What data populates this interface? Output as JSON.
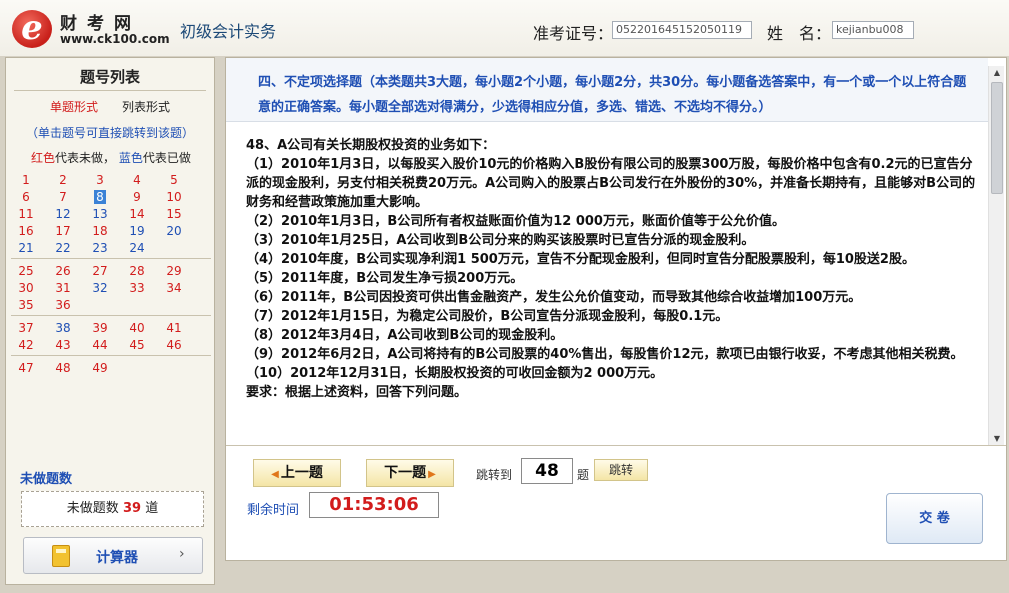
{
  "header": {
    "logo_name": "财考网",
    "logo_url": "www.ck100.com",
    "subject": "初级会计实务",
    "exam_no_label": "准考证号：",
    "exam_no_value": "052201645152050119",
    "name_label": "姓　名：",
    "name_value": "kejianbu008"
  },
  "sidebar": {
    "title": "题号列表",
    "mode_single": "单题形式",
    "mode_list": "列表形式",
    "jump_hint": "（单击题号可直接跳转到该题）",
    "legend_red": "红色",
    "legend_red_text": "代表未做，",
    "legend_blue": "蓝色",
    "legend_blue_text": "代表已做",
    "questions": [
      {
        "n": "1",
        "done": false
      },
      {
        "n": "2",
        "done": false
      },
      {
        "n": "3",
        "done": false
      },
      {
        "n": "4",
        "done": false
      },
      {
        "n": "5",
        "done": false
      },
      {
        "n": "6",
        "done": false
      },
      {
        "n": "7",
        "done": false
      },
      {
        "n": "8",
        "done": false,
        "current": true
      },
      {
        "n": "9",
        "done": false
      },
      {
        "n": "10",
        "done": false
      },
      {
        "n": "11",
        "done": false
      },
      {
        "n": "12",
        "done": true
      },
      {
        "n": "13",
        "done": true
      },
      {
        "n": "14",
        "done": false
      },
      {
        "n": "15",
        "done": false
      },
      {
        "n": "16",
        "done": false
      },
      {
        "n": "17",
        "done": false
      },
      {
        "n": "18",
        "done": false
      },
      {
        "n": "19",
        "done": true
      },
      {
        "n": "20",
        "done": true
      },
      {
        "n": "21",
        "done": true
      },
      {
        "n": "22",
        "done": true
      },
      {
        "n": "23",
        "done": true
      },
      {
        "n": "24",
        "done": true
      },
      {
        "n": "25",
        "done": false
      },
      {
        "n": "26",
        "done": false
      },
      {
        "n": "27",
        "done": false
      },
      {
        "n": "28",
        "done": false
      },
      {
        "n": "29",
        "done": false
      },
      {
        "n": "30",
        "done": false
      },
      {
        "n": "31",
        "done": false
      },
      {
        "n": "32",
        "done": true
      },
      {
        "n": "33",
        "done": false
      },
      {
        "n": "34",
        "done": false
      },
      {
        "n": "35",
        "done": false
      },
      {
        "n": "36",
        "done": false
      },
      {
        "n": "37",
        "done": false
      },
      {
        "n": "38",
        "done": true
      },
      {
        "n": "39",
        "done": false
      },
      {
        "n": "40",
        "done": false
      },
      {
        "n": "41",
        "done": false
      },
      {
        "n": "42",
        "done": false
      },
      {
        "n": "43",
        "done": false
      },
      {
        "n": "44",
        "done": false
      },
      {
        "n": "45",
        "done": false
      },
      {
        "n": "46",
        "done": false
      },
      {
        "n": "47",
        "done": false
      },
      {
        "n": "48",
        "done": false
      },
      {
        "n": "49",
        "done": false
      }
    ],
    "undone_title": "未做题数",
    "undone_label": "未做题数",
    "undone_count": "39",
    "undone_unit": "道",
    "calculator_label": "计算器",
    "calculator_chevron": "›"
  },
  "main": {
    "section_heading": "四、不定项选择题（本类题共3大题，每小题2个小题，每小题2分，共30分。每小题备选答案中，有一个或一个以上符合题意的正确答案。每小题全部选对得满分，少选得相应分值，多选、错选、不选均不得分。）",
    "question_title": "48、A公司有关长期股权投资的业务如下：",
    "items": [
      "（1）2010年1月3日，以每股买入股价10元的价格购入B股份有限公司的股票300万股，每股价格中包含有0.2元的已宣告分派的现金股利，另支付相关税费20万元。A公司购入的股票占B公司发行在外股份的30%，并准备长期持有，且能够对B公司的财务和经营政策施加重大影响。",
      "（2）2010年1月3日，B公司所有者权益账面价值为12 000万元，账面价值等于公允价值。",
      "（3）2010年1月25日，A公司收到B公司分来的购买该股票时已宣告分派的现金股利。",
      "（4）2010年度，B公司实现净利润1 500万元，宣告不分配现金股利，但同时宣告分配股票股利，每10股送2股。",
      "（5）2011年度，B公司发生净亏损200万元。",
      "（6）2011年，B公司因投资可供出售金融资产，发生公允价值变动，而导致其他综合收益增加100万元。",
      "（7）2012年1月15日，为稳定公司股价，B公司宣告分派现金股利，每股0.1元。",
      "（8）2012年3月4日，A公司收到B公司的现金股利。",
      "（9）2012年6月2日，A公司将持有的B公司股票的40%售出，每股售价12元，款项已由银行收妥，不考虑其他相关税费。",
      "（10）2012年12月31日，长期股权投资的可收回金额为2 000万元。",
      "要求：根据上述资料，回答下列问题。"
    ],
    "prev_label": "上一题",
    "next_label": "下一题",
    "jump_label": "跳转到",
    "jump_value": "48",
    "jump_unit": "题",
    "jump_button": "跳转",
    "remain_label": "剩余时间",
    "timer": "01:53:06",
    "submit_label": "交 卷"
  }
}
